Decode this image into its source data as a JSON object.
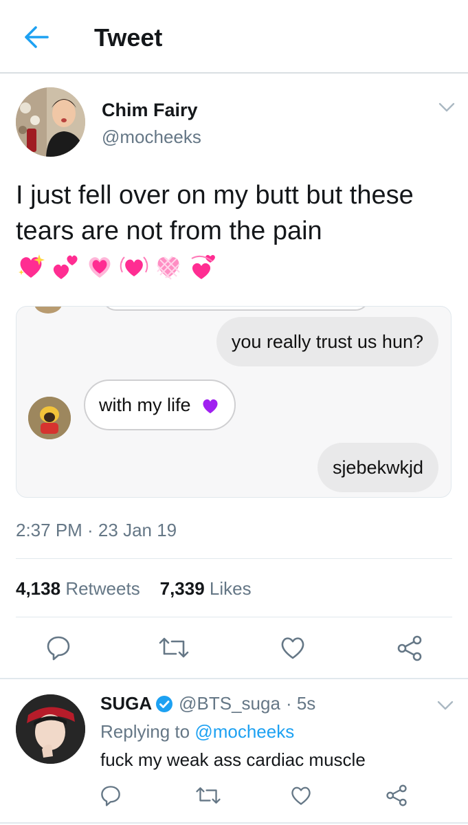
{
  "header": {
    "title": "Tweet"
  },
  "tweet": {
    "name": "Chim Fairy",
    "handle": "@mocheeks",
    "text": "I just fell over on my butt but these tears are not from the pain",
    "emojis": [
      "sparkling-heart",
      "two-hearts",
      "heart-with-ribbon",
      "beating-heart",
      "checkered-heart",
      "revolving-hearts"
    ],
    "timestamp": "2:37 PM · 23 Jan 19",
    "retweets_count": "4,138",
    "retweets_label": "Retweets",
    "likes_count": "7,339",
    "likes_label": "Likes",
    "chat": {
      "msg1": "you really trust us hun?",
      "msg2": "with my life",
      "msg3": "sjebekwkjd"
    }
  },
  "reply": {
    "name": "SUGA",
    "handle": "@BTS_suga",
    "time": "· 5s",
    "replying_prefix": "Replying to ",
    "replying_to": "@mocheeks",
    "text": "fuck my weak ass cardiac muscle"
  },
  "colors": {
    "accent": "#1da1f2",
    "secondary_text": "#657786",
    "heart_pink": "#ff2d92",
    "purple_heart": "#a020f0"
  }
}
